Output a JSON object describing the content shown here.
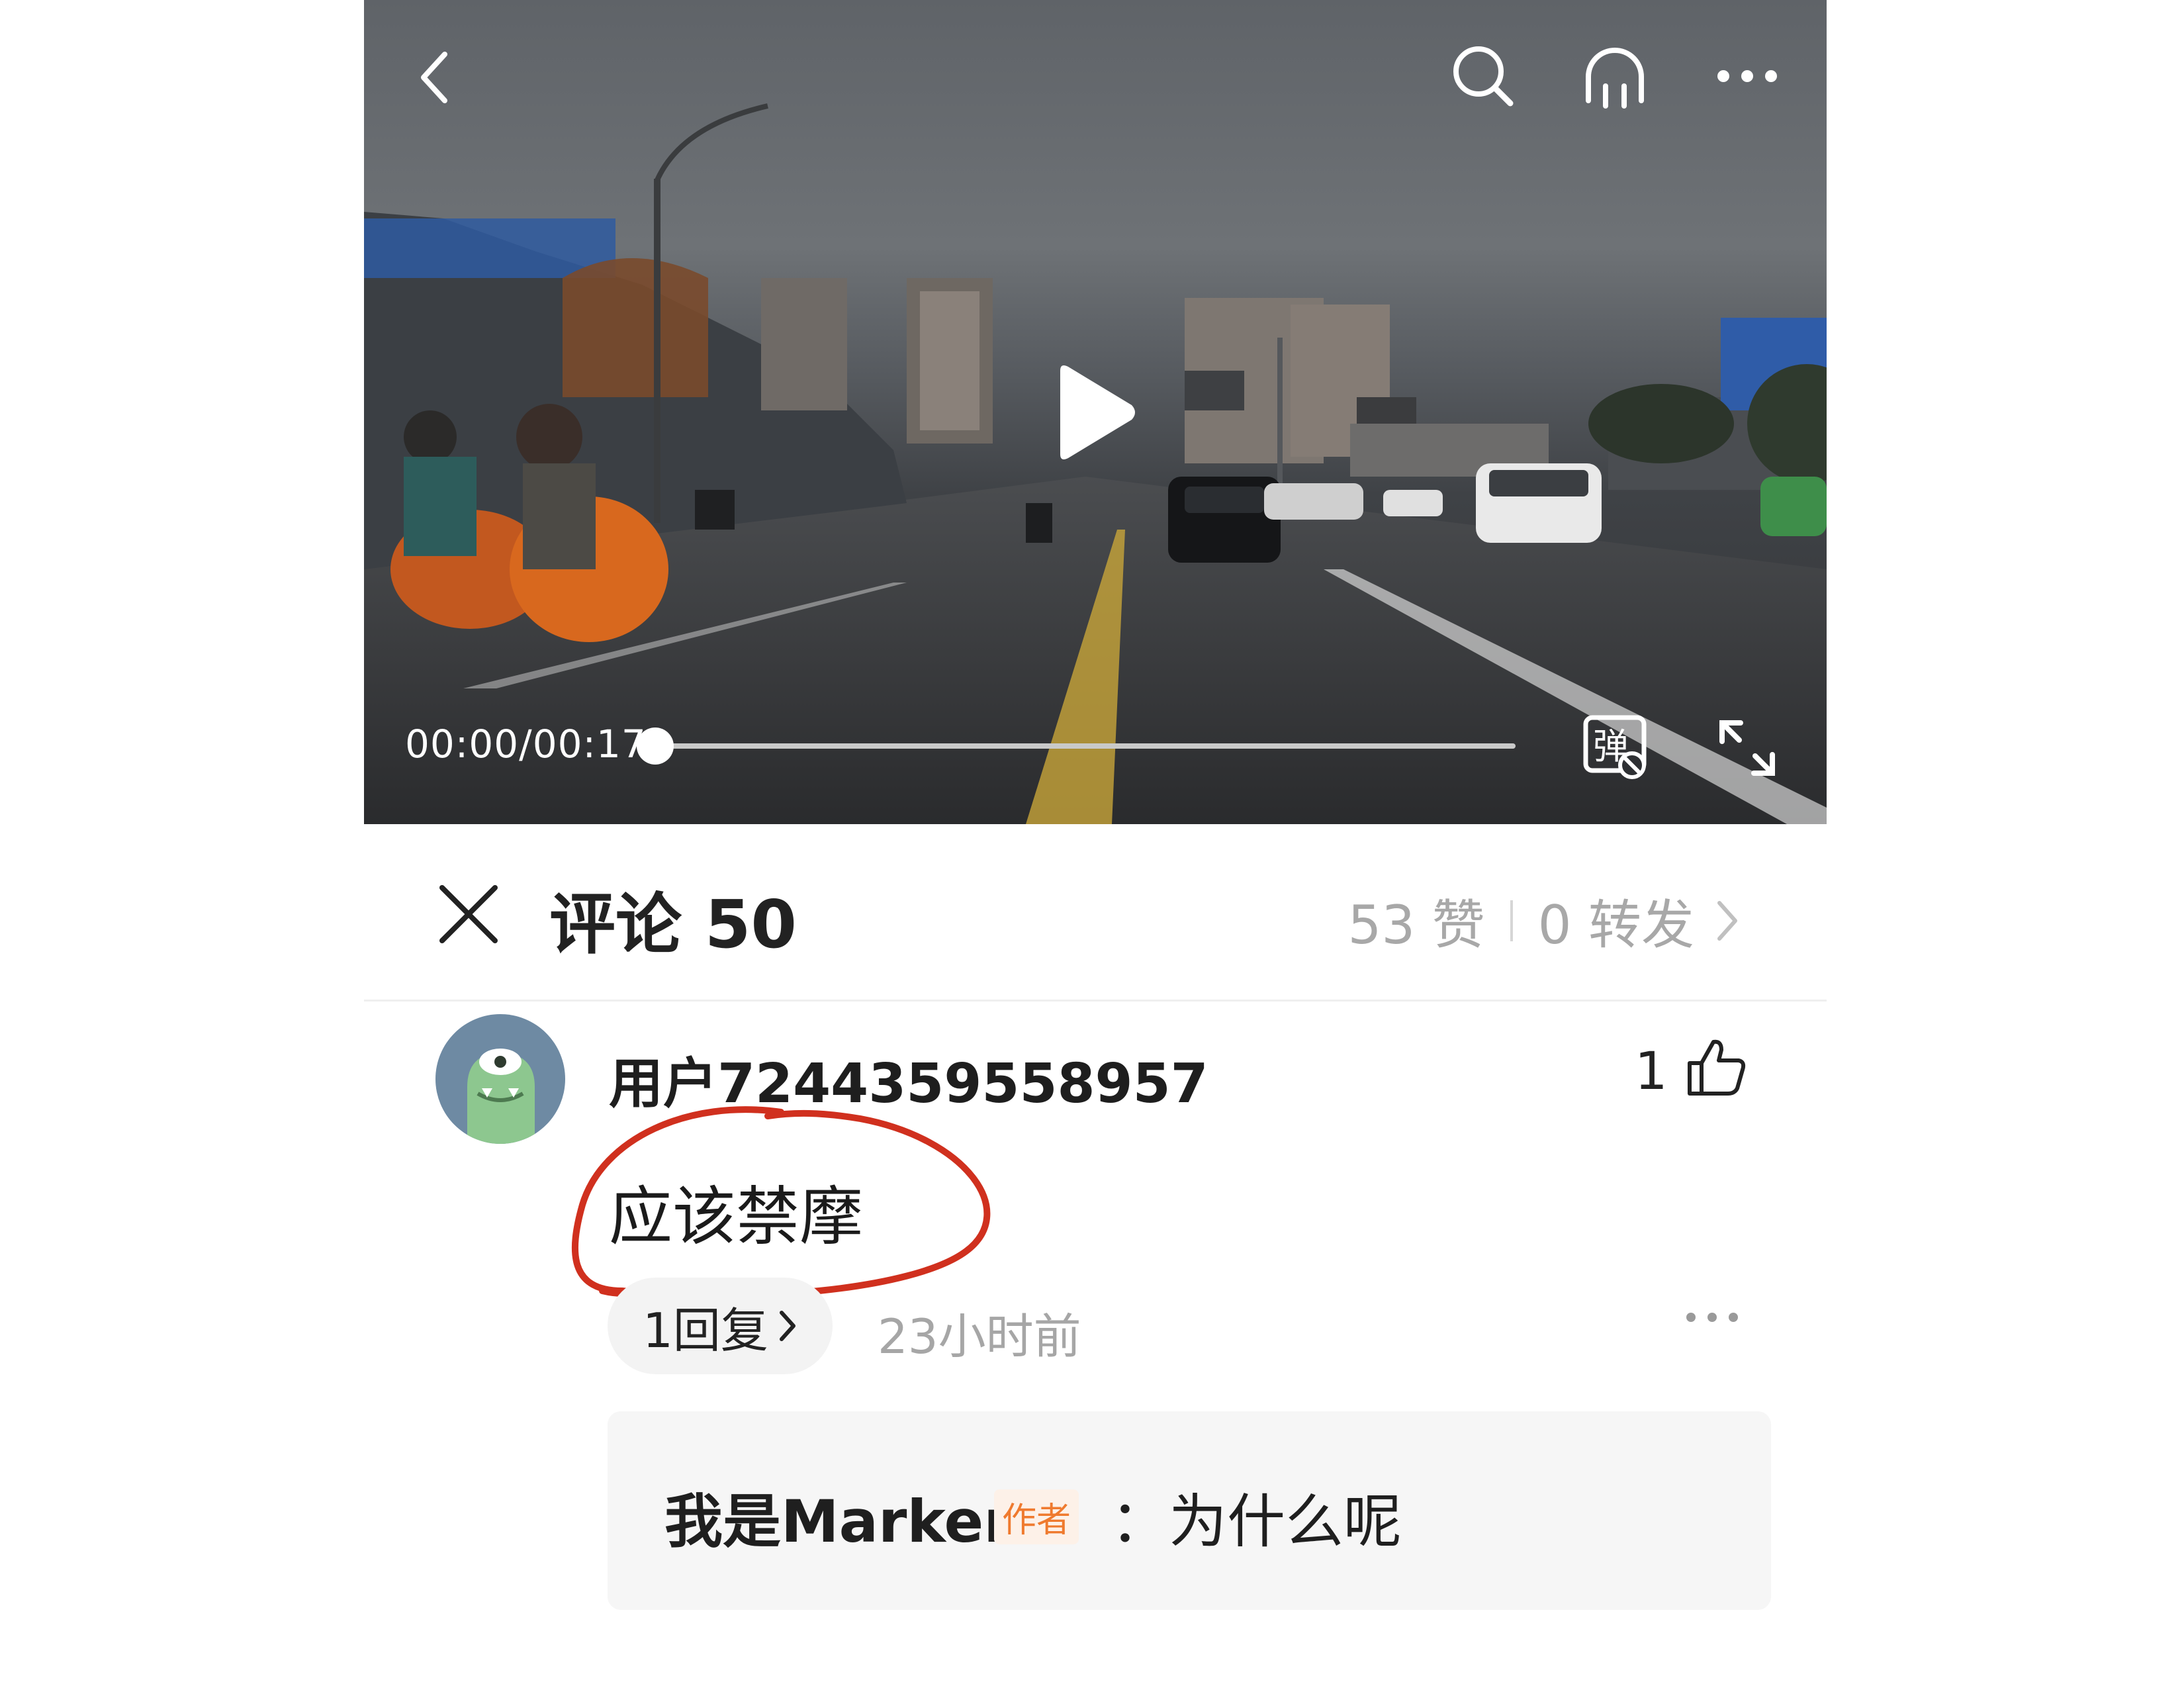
{
  "video": {
    "time_readout": "00:00/00:17",
    "progress_fraction": 0.0,
    "danmaku_icon_char": "弹"
  },
  "comment_header": {
    "title": "评论 50",
    "likes": "53 赞",
    "forwards": "0 转发"
  },
  "comment": {
    "username": "用户7244359558957",
    "like_count": "1",
    "text": "应该禁摩",
    "reply_pill": "1回复",
    "timestamp": "23小时前"
  },
  "reply": {
    "author": "我是Marker",
    "badge": "作者",
    "text": "：为什么呢"
  },
  "colors": {
    "annotation": "#d0301e",
    "badge": "#ef7a2e"
  }
}
